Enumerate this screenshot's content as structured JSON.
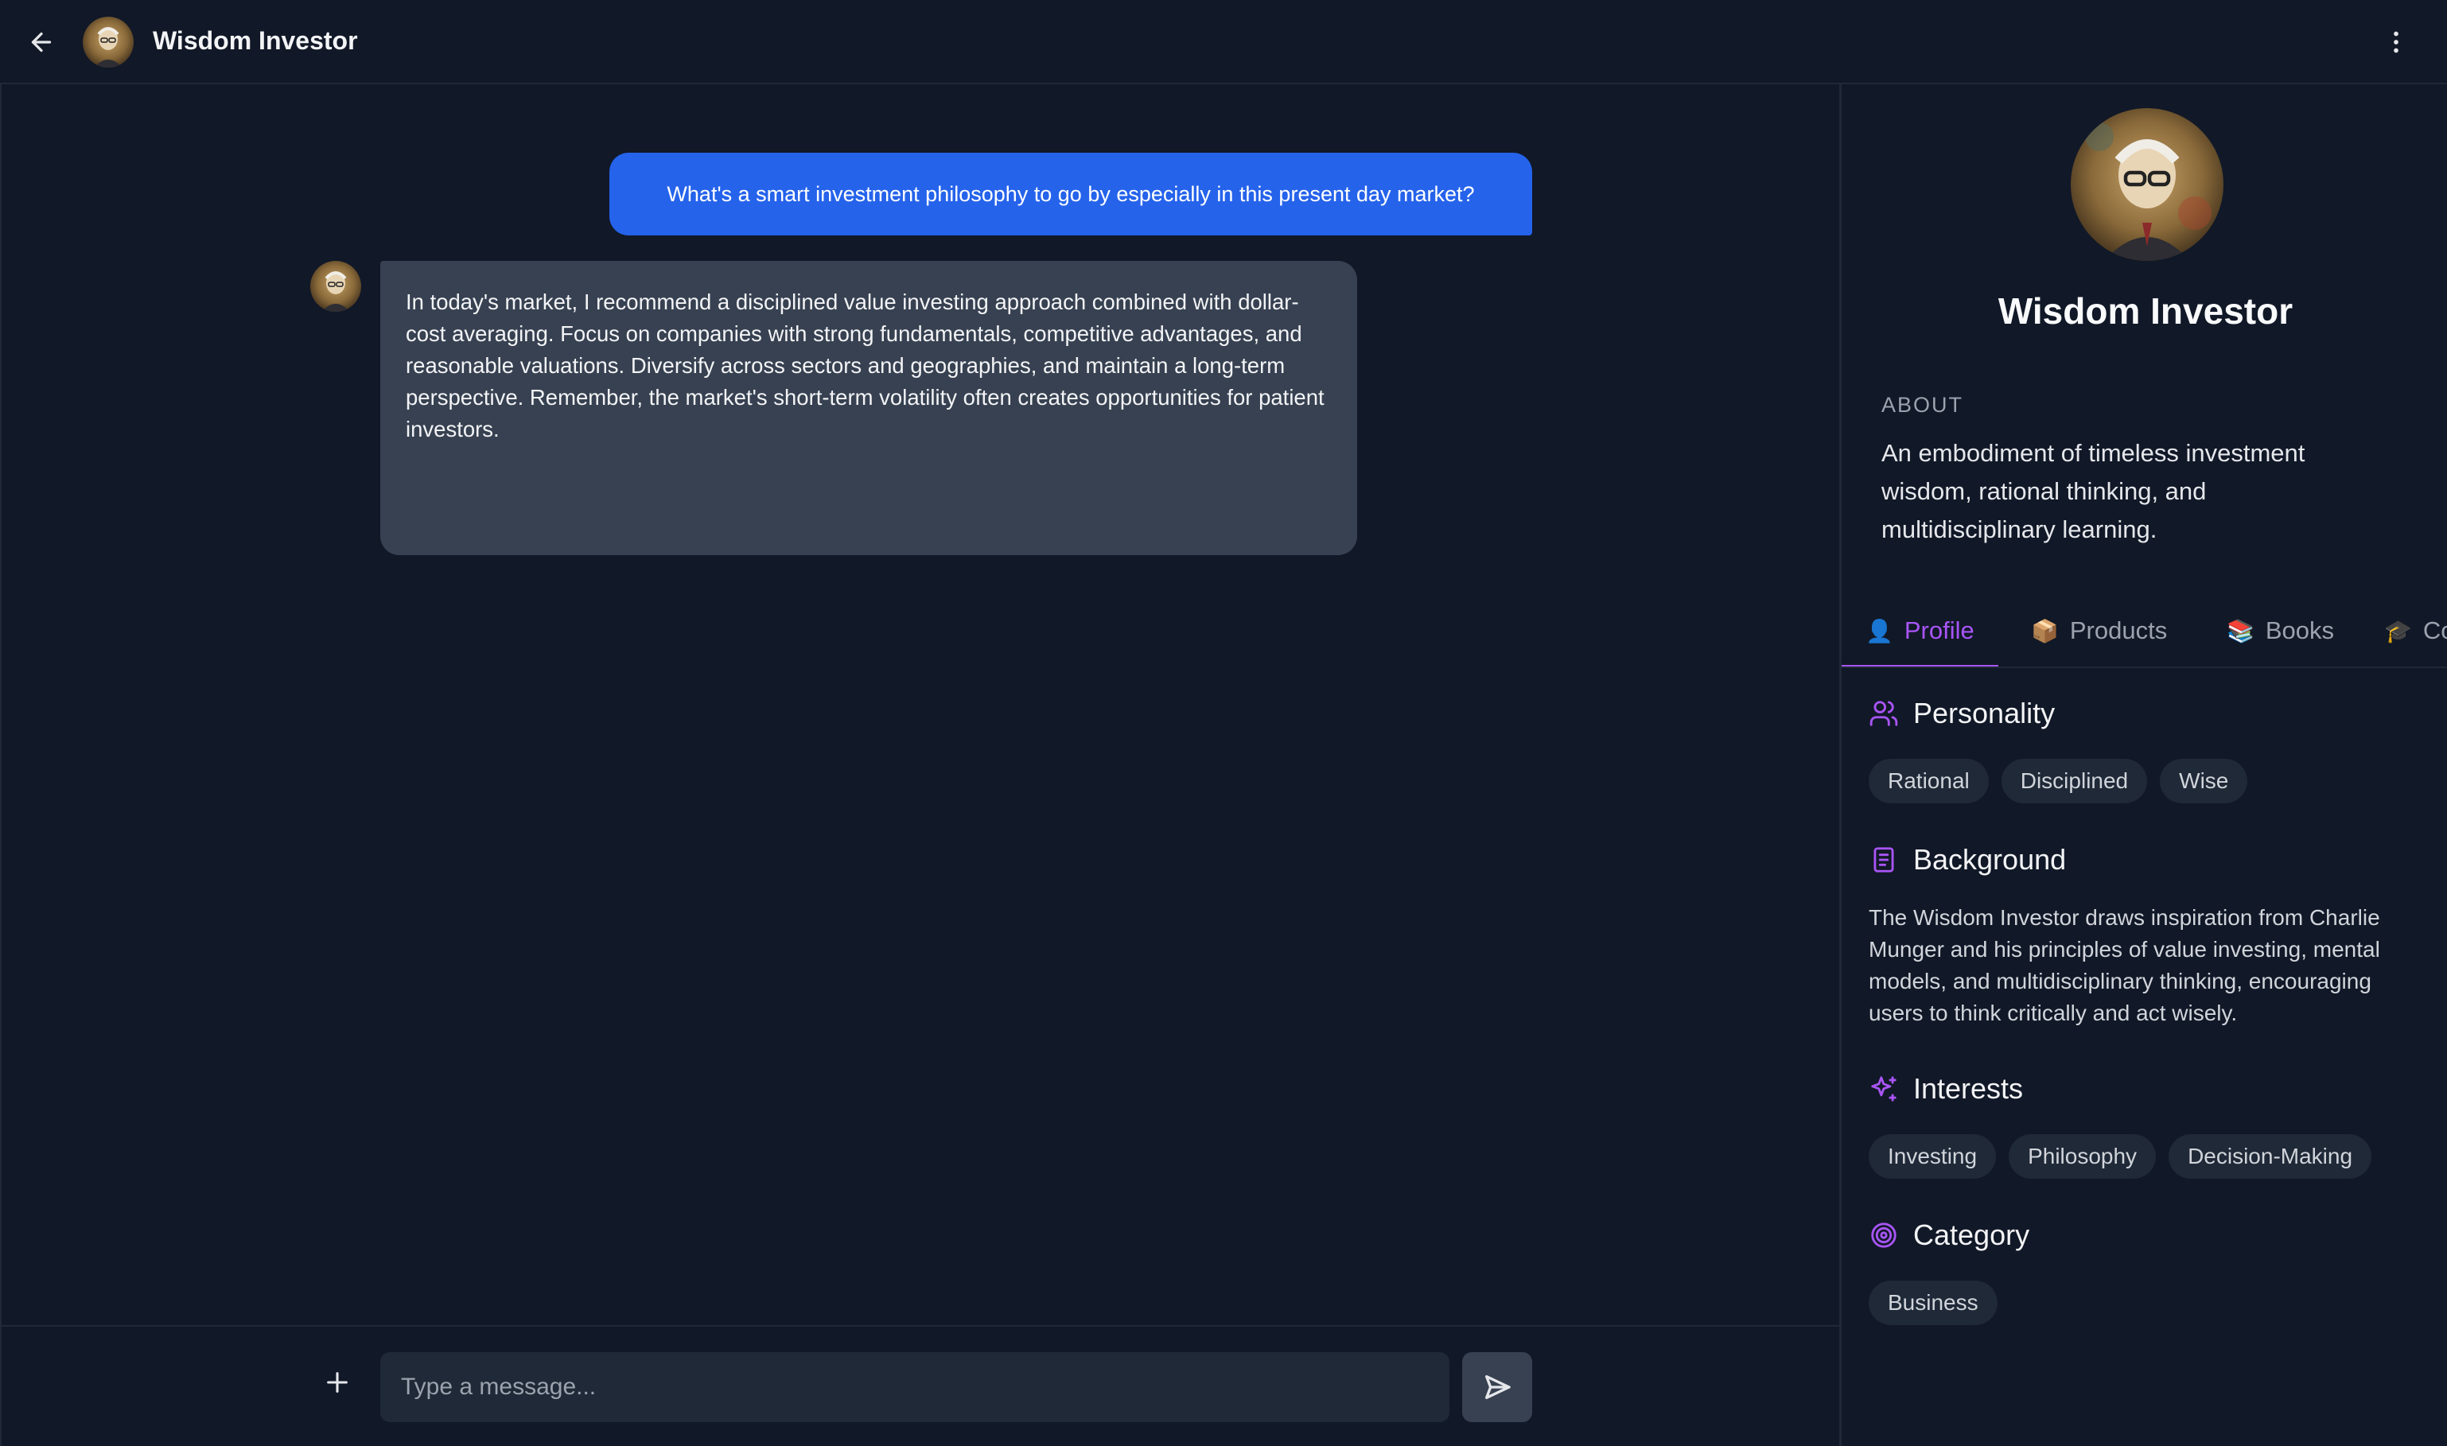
{
  "header": {
    "title": "Wisdom Investor"
  },
  "chat": {
    "user_message": "What's a smart investment philosophy to go by especially in this present day market?",
    "bot_message": "In today's market, I recommend a disciplined value investing approach combined with dollar-cost averaging. Focus on companies with strong fundamentals, competitive advantages, and reasonable valuations. Diversify across sectors and geographies, and maintain a long-term perspective. Remember, the market's short-term volatility often creates opportunities for patient investors."
  },
  "composer": {
    "placeholder": "Type a message..."
  },
  "profile": {
    "name": "Wisdom Investor",
    "about_label": "ABOUT",
    "about": "An embodiment of timeless investment wisdom, rational thinking, and multidisciplinary learning.",
    "tabs": [
      {
        "emoji": "👤",
        "label": "Profile"
      },
      {
        "emoji": "📦",
        "label": "Products"
      },
      {
        "emoji": "📚",
        "label": "Books"
      },
      {
        "emoji": "🎓",
        "label": "Co"
      }
    ],
    "personality": {
      "title": "Personality",
      "tags": [
        "Rational",
        "Disciplined",
        "Wise"
      ]
    },
    "background": {
      "title": "Background",
      "text": "The Wisdom Investor draws inspiration from Charlie Munger and his principles of value investing, mental models, and multidisciplinary thinking, encouraging users to think critically and act wisely."
    },
    "interests": {
      "title": "Interests",
      "tags": [
        "Investing",
        "Philosophy",
        "Decision-Making"
      ]
    },
    "category": {
      "title": "Category",
      "tags": [
        "Business"
      ]
    }
  },
  "colors": {
    "accent": "#a855f7",
    "user_bubble": "#2563eb",
    "bot_bubble": "#374151",
    "background": "#111827"
  }
}
